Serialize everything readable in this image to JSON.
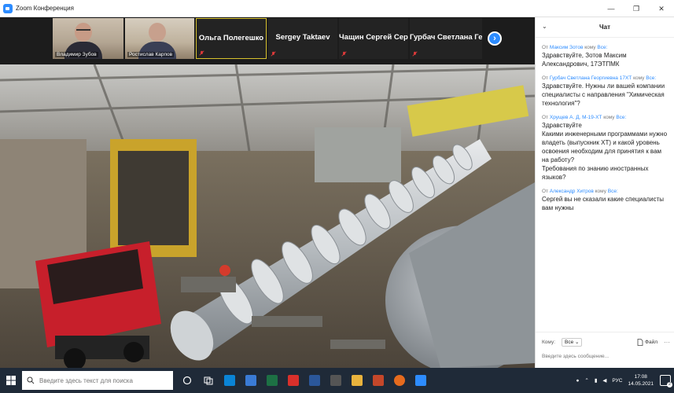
{
  "window": {
    "title": "Zoom Конференция",
    "minimize": "—",
    "maximize": "❐",
    "close": "✕"
  },
  "participants": [
    {
      "name": "Владимир Зубов",
      "has_video": true
    },
    {
      "name": "Ростислав Карпов",
      "has_video": true
    },
    {
      "name": "Ольга Полегешко",
      "has_video": false,
      "active_speaker": true
    },
    {
      "name": "Sergey Taktaev",
      "has_video": false
    },
    {
      "name": "Чащин Сергей Серг...",
      "has_video": false
    },
    {
      "name": "Гурбач Светлана Гео...",
      "has_video": false
    }
  ],
  "participants_next": "›",
  "chat": {
    "title": "Чат",
    "collapse_icon": "chevron-down-icon",
    "messages": [
      {
        "from_label": "От",
        "sender": "Максим Зотов",
        "to_label": "кому",
        "to": "Все:",
        "text": "Здравствуйте, Зотов Максим Александрович, 17ЭТПМК"
      },
      {
        "from_label": "От",
        "sender": "Гурбач Светлана Георгиевна 17ХТ",
        "to_label": "кому",
        "to": "Все:",
        "text": "Здравствуйте. Нужны ли вашей компании специалисты с направления \"Химическая технология\"?"
      },
      {
        "from_label": "От",
        "sender": "Хрущев А. Д. М-19-ХТ",
        "to_label": "кому",
        "to": "Все:",
        "text": "Здравствуйте\nКакими инженерными программами нужно владеть (выпускник ХТ) и какой уровень освоения необходим для принятия к вам на работу?\nТребования по знанию иностранных языков?"
      },
      {
        "from_label": "От",
        "sender": "Александр Хитров",
        "to_label": "кому",
        "to": "Все:",
        "text": "Сергей вы не сказали какие специалисты вам нужны"
      }
    ],
    "to_label": "Кому:",
    "to_value": "Все",
    "file_label": "Файл",
    "more": "···",
    "input_placeholder": "Введите здесь сообщение..."
  },
  "taskbar": {
    "search_placeholder": "Введите здесь текст для поиска",
    "apps": [
      {
        "name": "cortana",
        "color": "#ffffff"
      },
      {
        "name": "task-view",
        "color": "#ffffff"
      },
      {
        "name": "mail",
        "color": "#0a84d6"
      },
      {
        "name": "store",
        "color": "#3a7bd5"
      },
      {
        "name": "excel",
        "color": "#1d7044"
      },
      {
        "name": "acrobat",
        "color": "#d9302b"
      },
      {
        "name": "word",
        "color": "#2b579a"
      },
      {
        "name": "calendar",
        "color": "#555555"
      },
      {
        "name": "explorer",
        "color": "#e9b33d"
      },
      {
        "name": "powerpoint",
        "color": "#c4472a"
      },
      {
        "name": "firefox",
        "color": "#e66b1e"
      },
      {
        "name": "zoom",
        "color": "#2d8cff"
      }
    ],
    "language": "РУС",
    "time": "17:08",
    "date": "14.05.2021",
    "notifications": "2"
  }
}
